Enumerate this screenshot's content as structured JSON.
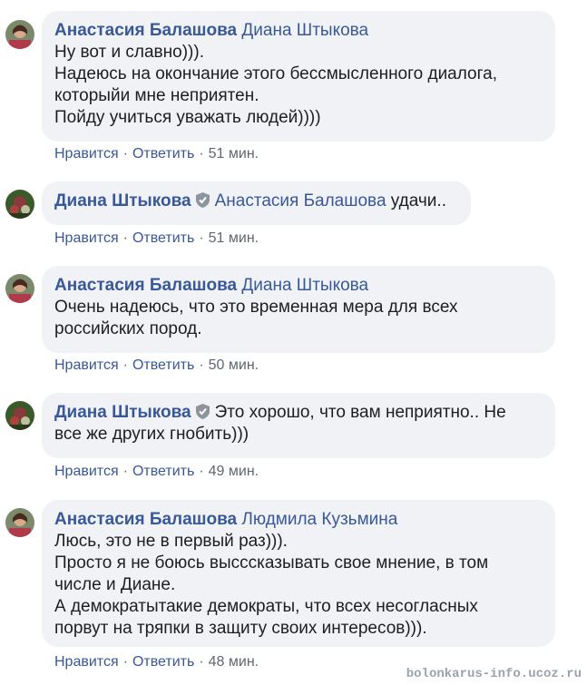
{
  "actions": {
    "like": "Нравится",
    "reply": "Ответить",
    "sep": "·"
  },
  "comments": [
    {
      "author": "Анастасия Балашова",
      "mention": "Диана Штыкова",
      "verified": false,
      "first_line_rest": "",
      "lines": [
        "Ну вот и славно))).",
        "Надеюсь на окончание этого бессмысленного диалога,",
        "которыйи мне неприятен.",
        "Пойду учиться уважать людей))))"
      ],
      "time": "51 мин."
    },
    {
      "author": "Диана Штыкова",
      "mention": "Анастасия Балашова",
      "verified": true,
      "first_line_rest": "удачи..",
      "lines": [],
      "time": "51 мин."
    },
    {
      "author": "Анастасия Балашова",
      "mention": "Диана Штыкова",
      "verified": false,
      "first_line_rest": "",
      "lines": [
        "Очень надеюсь, что это временная мера для всех",
        "российских пород."
      ],
      "time": "50 мин."
    },
    {
      "author": "Диана Штыкова",
      "mention": "",
      "verified": true,
      "first_line_rest": "Это хорошо, что вам неприятно.. Не",
      "lines": [
        "все же других гнобить)))"
      ],
      "time": "49 мин."
    },
    {
      "author": "Анастасия Балашова",
      "mention": "Людмила Кузьмина",
      "verified": false,
      "first_line_rest": "",
      "lines": [
        "Люсь, это не в первый раз))).",
        "Просто я не боюсь высссказывать свое мнение, в том",
        "числе и Диане.",
        "А демократытакие демократы, что всех несогласных",
        "порвут на тряпки в защиту своих интересов)))."
      ],
      "time": "48 мин."
    }
  ],
  "watermark": "bolonkarus-info.ucoz.ru",
  "colors": {
    "bubble": "#f0f2f5",
    "link": "#385898",
    "text": "#1c1e21",
    "meta": "#606770"
  }
}
